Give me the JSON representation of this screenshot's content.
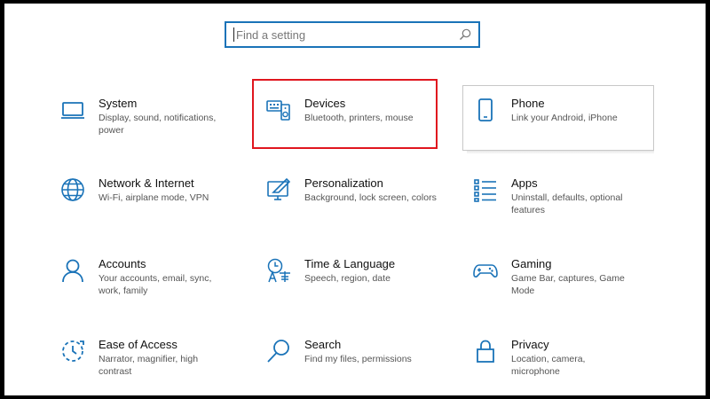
{
  "search": {
    "placeholder": "Find a setting",
    "icon": "search-icon"
  },
  "accent_color": "#1a73b8",
  "highlight_color": "#e0161e",
  "tiles": [
    {
      "id": "system",
      "icon": "monitor-icon",
      "title": "System",
      "desc": "Display, sound, notifications, power"
    },
    {
      "id": "devices",
      "icon": "devices-icon",
      "title": "Devices",
      "desc": "Bluetooth, printers, mouse"
    },
    {
      "id": "phone",
      "icon": "phone-icon",
      "title": "Phone",
      "desc": "Link your Android, iPhone"
    },
    {
      "id": "network",
      "icon": "globe-icon",
      "title": "Network & Internet",
      "desc": "Wi-Fi, airplane mode, VPN"
    },
    {
      "id": "personalization",
      "icon": "personalization-icon",
      "title": "Personalization",
      "desc": "Background, lock screen, colors"
    },
    {
      "id": "apps",
      "icon": "apps-list-icon",
      "title": "Apps",
      "desc": "Uninstall, defaults, optional features"
    },
    {
      "id": "accounts",
      "icon": "person-icon",
      "title": "Accounts",
      "desc": "Your accounts, email, sync, work, family"
    },
    {
      "id": "time-language",
      "icon": "time-language-icon",
      "title": "Time & Language",
      "desc": "Speech, region, date"
    },
    {
      "id": "gaming",
      "icon": "gamepad-icon",
      "title": "Gaming",
      "desc": "Game Bar, captures, Game Mode"
    },
    {
      "id": "ease-of-access",
      "icon": "ease-of-access-icon",
      "title": "Ease of Access",
      "desc": "Narrator, magnifier, high contrast"
    },
    {
      "id": "search",
      "icon": "magnifier-icon",
      "title": "Search",
      "desc": "Find my files, permissions"
    },
    {
      "id": "privacy",
      "icon": "lock-icon",
      "title": "Privacy",
      "desc": "Location, camera, microphone"
    }
  ]
}
